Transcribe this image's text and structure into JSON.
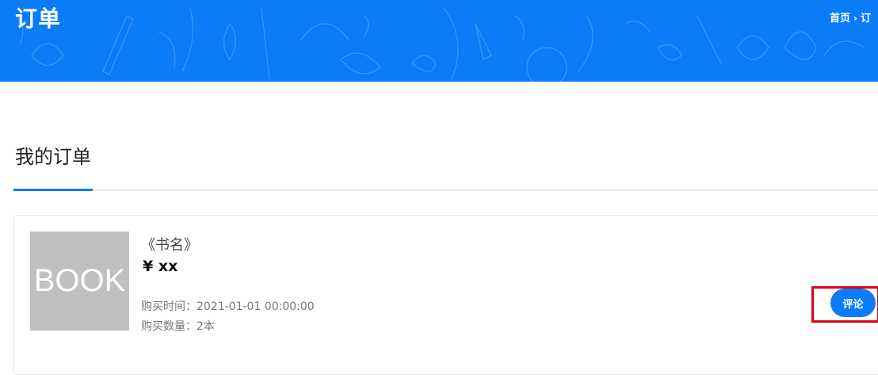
{
  "header": {
    "title": "订单",
    "breadcrumb": {
      "home": "首页",
      "separator": "›",
      "current": "订"
    },
    "background_color": "#0a7cf8"
  },
  "main": {
    "section_title": "我的订单",
    "accent_color": "#0a7cf8",
    "order": {
      "cover_text": "BOOK",
      "book_name": "《书名》",
      "price": "¥ xx",
      "purchase_time": "购买时间：2021-01-01 00:00:00",
      "purchase_qty": "购买数量：2本",
      "comment_button": "评论"
    }
  }
}
